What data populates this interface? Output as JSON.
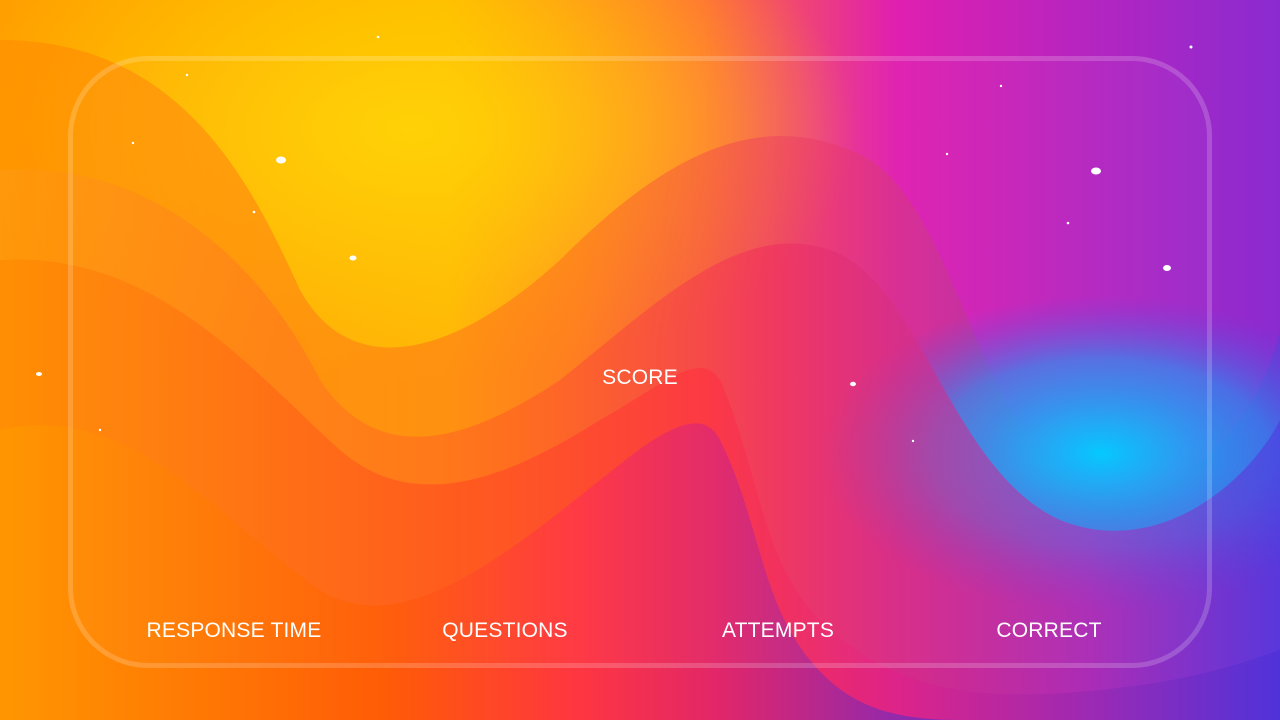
{
  "score": {
    "label": "SCORE"
  },
  "stats": {
    "response_time_label": "RESPONSE TIME",
    "questions_label": "QUESTIONS",
    "attempts_label": "ATTEMPTS",
    "correct_label": "CORRECT"
  },
  "theme": {
    "orange": "#ff8c00",
    "yellow": "#ffc400",
    "red": "#ff3d2e",
    "magenta": "#d81bc0",
    "purple": "#7b2fd0",
    "cyan": "#00c2ff",
    "particle_color": "#ffffff"
  }
}
